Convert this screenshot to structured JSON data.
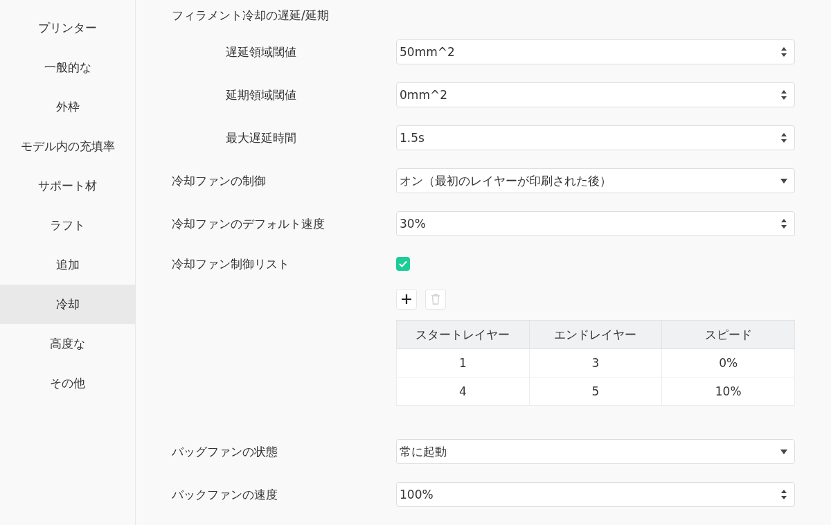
{
  "sidebar": {
    "items": [
      {
        "label": "プリンター",
        "selected": false
      },
      {
        "label": "一般的な",
        "selected": false
      },
      {
        "label": "外枠",
        "selected": false
      },
      {
        "label": "モデル内の充填率",
        "selected": false
      },
      {
        "label": "サポート材",
        "selected": false
      },
      {
        "label": "ラフト",
        "selected": false
      },
      {
        "label": "追加",
        "selected": false
      },
      {
        "label": "冷却",
        "selected": true
      },
      {
        "label": "高度な",
        "selected": false
      },
      {
        "label": "その他",
        "selected": false
      }
    ]
  },
  "settings": [
    {
      "kind": "heading",
      "label": "フィラメント冷却の遅延/延期",
      "children": [
        {
          "kind": "spin",
          "label": "遅延領域閾値",
          "value": "50mm^2"
        },
        {
          "kind": "spin",
          "label": "延期領域閾値",
          "value": "0mm^2"
        },
        {
          "kind": "spin",
          "label": "最大遅延時間",
          "value": "1.5s"
        }
      ]
    },
    {
      "kind": "select",
      "label": "冷却ファンの制御",
      "value": "オン（最初のレイヤーが印刷された後）"
    },
    {
      "kind": "spin",
      "label": "冷却ファンのデフォルト速度",
      "value": "30%"
    },
    {
      "kind": "checkbox",
      "label": "冷却ファン制御リスト",
      "checked": true
    },
    {
      "kind": "table",
      "delete_disabled": true,
      "columns": [
        "スタートレイヤー",
        "エンドレイヤー",
        "スピード"
      ],
      "rows": [
        [
          "1",
          "3",
          "0%"
        ],
        [
          "4",
          "5",
          "10%"
        ]
      ]
    },
    {
      "kind": "select",
      "label": "バッグファンの状態",
      "value": "常に起動"
    },
    {
      "kind": "spin",
      "label": "バックファンの速度",
      "value": "100%"
    }
  ]
}
